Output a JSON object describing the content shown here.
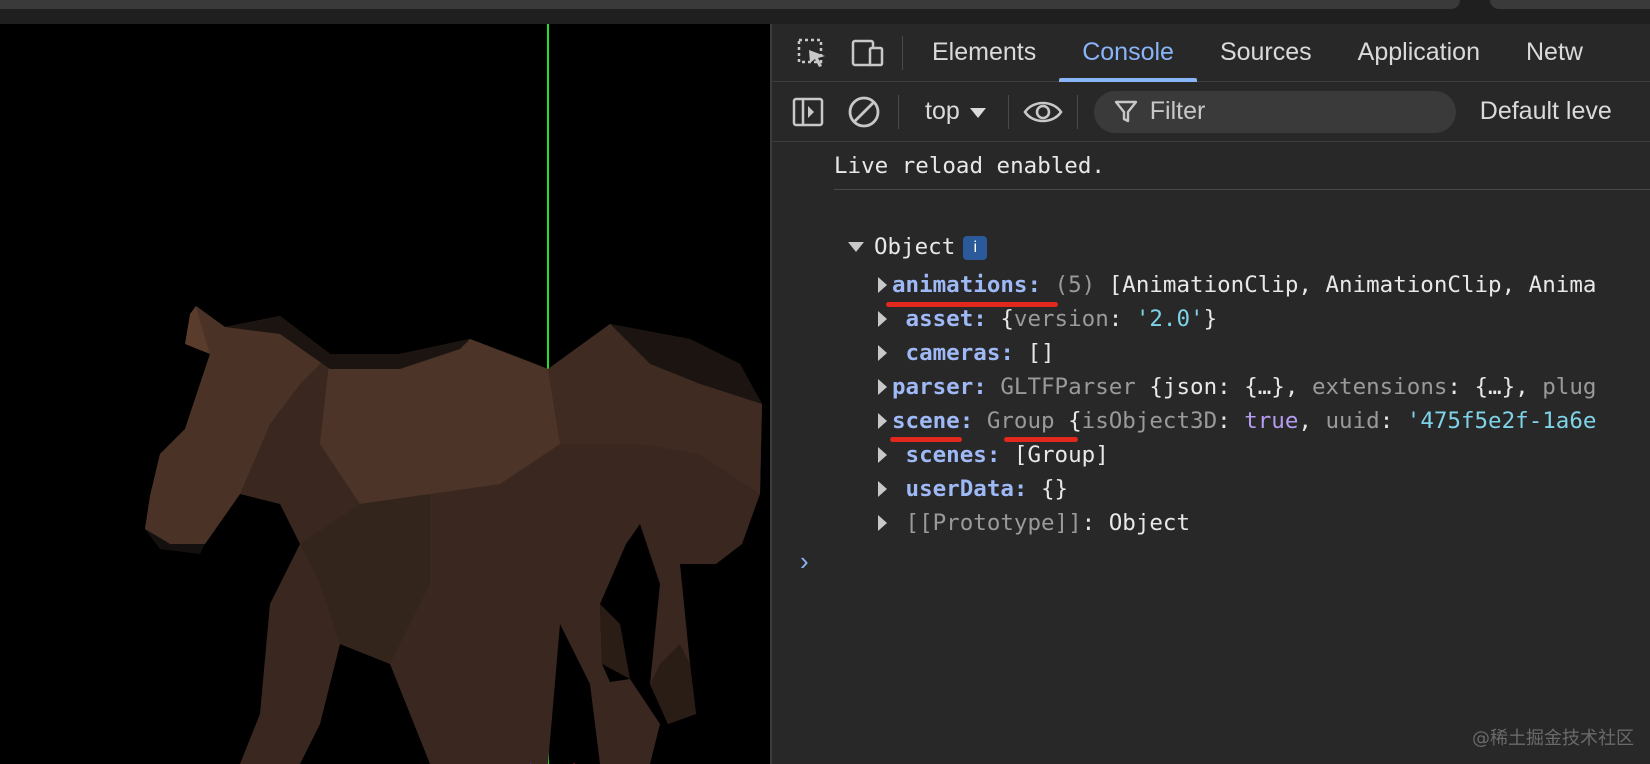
{
  "devtools": {
    "tabs": [
      "Elements",
      "Console",
      "Sources",
      "Application",
      "Netw"
    ],
    "active_tab": "Console",
    "context": "top",
    "filter_placeholder": "Filter",
    "levels_label": "Default leve"
  },
  "console": {
    "message": "Live reload enabled.",
    "object_label": "Object",
    "info_badge": "i",
    "properties": [
      {
        "key": "animations",
        "separator": ":",
        "count": "(5)",
        "value": "[AnimationClip, AnimationClip, Anima"
      },
      {
        "key": "asset",
        "separator": ":",
        "open": "{",
        "subkey": "version",
        "subsep": ":",
        "str": "'2.0'",
        "close": "}"
      },
      {
        "key": "cameras",
        "separator": ":",
        "value": "[]"
      },
      {
        "key": "parser",
        "separator": ":",
        "type": "GLTFParser",
        "value1": "{json:",
        "v2": " {…}, ",
        "v3": "extensions",
        "v4": ": {…}, ",
        "v5": "plug"
      },
      {
        "key": "scene",
        "separator": ":",
        "type": "Group",
        "open": "{",
        "subkey": "isObject3D",
        "subsep": ": ",
        "kw": "true",
        "sep2": ", ",
        "subkey2": "uuid",
        "subsep2": ": ",
        "str": "'475f5e2f-1a6e"
      },
      {
        "key": "scenes",
        "separator": ":",
        "value": "[Group]"
      },
      {
        "key": "userData",
        "separator": ":",
        "value": "{}"
      },
      {
        "key": "[[Prototype]]",
        "separator": ":",
        "value": "Object"
      }
    ]
  },
  "watermark": "@稀土掘金技术社区",
  "colors": {
    "accent": "#8ab4f8",
    "underline": "#e2271c",
    "axis_green": "#22e022"
  }
}
